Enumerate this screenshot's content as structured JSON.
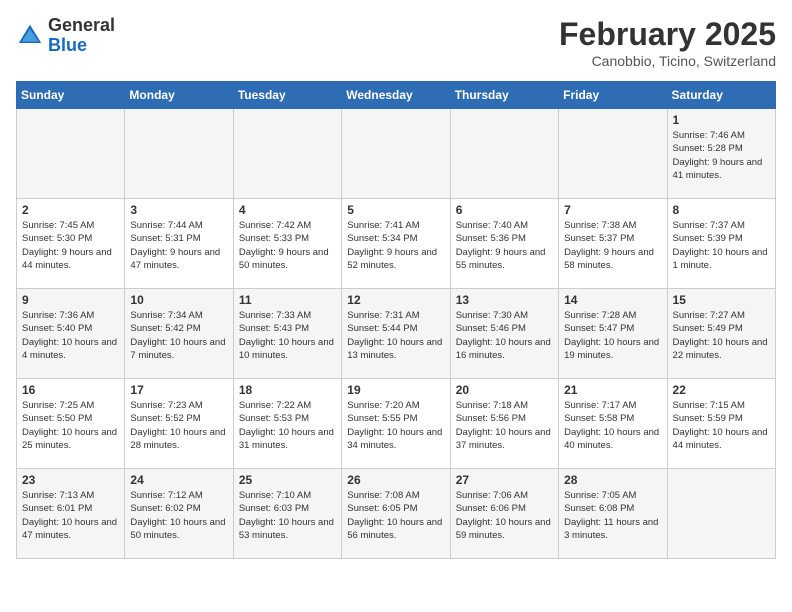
{
  "header": {
    "logo_general": "General",
    "logo_blue": "Blue",
    "month_year": "February 2025",
    "location": "Canobbio, Ticino, Switzerland"
  },
  "weekdays": [
    "Sunday",
    "Monday",
    "Tuesday",
    "Wednesday",
    "Thursday",
    "Friday",
    "Saturday"
  ],
  "weeks": [
    [
      {
        "day": "",
        "info": ""
      },
      {
        "day": "",
        "info": ""
      },
      {
        "day": "",
        "info": ""
      },
      {
        "day": "",
        "info": ""
      },
      {
        "day": "",
        "info": ""
      },
      {
        "day": "",
        "info": ""
      },
      {
        "day": "1",
        "info": "Sunrise: 7:46 AM\nSunset: 5:28 PM\nDaylight: 9 hours and 41 minutes."
      }
    ],
    [
      {
        "day": "2",
        "info": "Sunrise: 7:45 AM\nSunset: 5:30 PM\nDaylight: 9 hours and 44 minutes."
      },
      {
        "day": "3",
        "info": "Sunrise: 7:44 AM\nSunset: 5:31 PM\nDaylight: 9 hours and 47 minutes."
      },
      {
        "day": "4",
        "info": "Sunrise: 7:42 AM\nSunset: 5:33 PM\nDaylight: 9 hours and 50 minutes."
      },
      {
        "day": "5",
        "info": "Sunrise: 7:41 AM\nSunset: 5:34 PM\nDaylight: 9 hours and 52 minutes."
      },
      {
        "day": "6",
        "info": "Sunrise: 7:40 AM\nSunset: 5:36 PM\nDaylight: 9 hours and 55 minutes."
      },
      {
        "day": "7",
        "info": "Sunrise: 7:38 AM\nSunset: 5:37 PM\nDaylight: 9 hours and 58 minutes."
      },
      {
        "day": "8",
        "info": "Sunrise: 7:37 AM\nSunset: 5:39 PM\nDaylight: 10 hours and 1 minute."
      }
    ],
    [
      {
        "day": "9",
        "info": "Sunrise: 7:36 AM\nSunset: 5:40 PM\nDaylight: 10 hours and 4 minutes."
      },
      {
        "day": "10",
        "info": "Sunrise: 7:34 AM\nSunset: 5:42 PM\nDaylight: 10 hours and 7 minutes."
      },
      {
        "day": "11",
        "info": "Sunrise: 7:33 AM\nSunset: 5:43 PM\nDaylight: 10 hours and 10 minutes."
      },
      {
        "day": "12",
        "info": "Sunrise: 7:31 AM\nSunset: 5:44 PM\nDaylight: 10 hours and 13 minutes."
      },
      {
        "day": "13",
        "info": "Sunrise: 7:30 AM\nSunset: 5:46 PM\nDaylight: 10 hours and 16 minutes."
      },
      {
        "day": "14",
        "info": "Sunrise: 7:28 AM\nSunset: 5:47 PM\nDaylight: 10 hours and 19 minutes."
      },
      {
        "day": "15",
        "info": "Sunrise: 7:27 AM\nSunset: 5:49 PM\nDaylight: 10 hours and 22 minutes."
      }
    ],
    [
      {
        "day": "16",
        "info": "Sunrise: 7:25 AM\nSunset: 5:50 PM\nDaylight: 10 hours and 25 minutes."
      },
      {
        "day": "17",
        "info": "Sunrise: 7:23 AM\nSunset: 5:52 PM\nDaylight: 10 hours and 28 minutes."
      },
      {
        "day": "18",
        "info": "Sunrise: 7:22 AM\nSunset: 5:53 PM\nDaylight: 10 hours and 31 minutes."
      },
      {
        "day": "19",
        "info": "Sunrise: 7:20 AM\nSunset: 5:55 PM\nDaylight: 10 hours and 34 minutes."
      },
      {
        "day": "20",
        "info": "Sunrise: 7:18 AM\nSunset: 5:56 PM\nDaylight: 10 hours and 37 minutes."
      },
      {
        "day": "21",
        "info": "Sunrise: 7:17 AM\nSunset: 5:58 PM\nDaylight: 10 hours and 40 minutes."
      },
      {
        "day": "22",
        "info": "Sunrise: 7:15 AM\nSunset: 5:59 PM\nDaylight: 10 hours and 44 minutes."
      }
    ],
    [
      {
        "day": "23",
        "info": "Sunrise: 7:13 AM\nSunset: 6:01 PM\nDaylight: 10 hours and 47 minutes."
      },
      {
        "day": "24",
        "info": "Sunrise: 7:12 AM\nSunset: 6:02 PM\nDaylight: 10 hours and 50 minutes."
      },
      {
        "day": "25",
        "info": "Sunrise: 7:10 AM\nSunset: 6:03 PM\nDaylight: 10 hours and 53 minutes."
      },
      {
        "day": "26",
        "info": "Sunrise: 7:08 AM\nSunset: 6:05 PM\nDaylight: 10 hours and 56 minutes."
      },
      {
        "day": "27",
        "info": "Sunrise: 7:06 AM\nSunset: 6:06 PM\nDaylight: 10 hours and 59 minutes."
      },
      {
        "day": "28",
        "info": "Sunrise: 7:05 AM\nSunset: 6:08 PM\nDaylight: 11 hours and 3 minutes."
      },
      {
        "day": "",
        "info": ""
      }
    ]
  ]
}
